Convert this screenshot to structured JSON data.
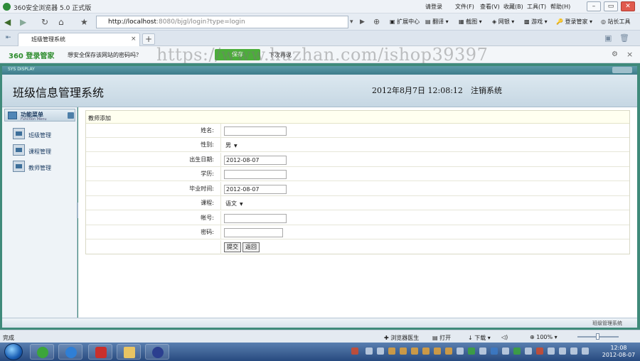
{
  "browser": {
    "title": "360安全浏览器 5.0 正式版",
    "menu": {
      "login": "请登录",
      "file": "文件(F)",
      "view": "查看(V)",
      "favorites": "收藏(B)",
      "tools": "工具(T)",
      "help": "帮助(H)"
    },
    "address": {
      "host": "http://localhost",
      "rest": ":8080/bjgl/login?type=login"
    },
    "toolbar": {
      "ext": "扩展中心",
      "translate": "翻译",
      "screenshot": "截图",
      "bank": "网银",
      "games": "游戏",
      "login_mgr": "登录管家",
      "webmaster": "站长工具"
    },
    "tab": {
      "label": "班级管理系统"
    },
    "notify": {
      "brand": "360 登录管家",
      "message": "想安全保存该网站的密码吗？",
      "yes": "保存",
      "no": "下次再说"
    },
    "watermark": "https://www.huzhan.com/ishop39397",
    "status": {
      "done": "完成",
      "doctor": "浏览器医生",
      "open": "打开",
      "download": "下载",
      "zoom": "100%"
    }
  },
  "app": {
    "frame_title": "SYS DISPLAY",
    "title": "班级信息管理系统",
    "datetime": "2012年8月7日  12:08:12",
    "logout": "注销系统",
    "footer": "班级管理系统",
    "sidebar": {
      "header": "功能菜单",
      "header_sub": "Function Menu",
      "items": [
        {
          "label": "班级管理"
        },
        {
          "label": "课程管理"
        },
        {
          "label": "教师管理"
        }
      ]
    },
    "form": {
      "title": "教师添加",
      "fields": [
        {
          "label": "姓名:",
          "value": ""
        },
        {
          "label": "性别:",
          "value": "男"
        },
        {
          "label": "出生日期:",
          "value": "2012-08-07"
        },
        {
          "label": "学历:",
          "value": ""
        },
        {
          "label": "毕业时间:",
          "value": "2012-08-07"
        },
        {
          "label": "课程:",
          "value": "语文"
        },
        {
          "label": "帐号:",
          "value": ""
        },
        {
          "label": "密码:",
          "value": ""
        }
      ],
      "submit": "提交",
      "back": "返回"
    }
  },
  "taskbar": {
    "time": "12:08",
    "date": "2012-08-07"
  }
}
